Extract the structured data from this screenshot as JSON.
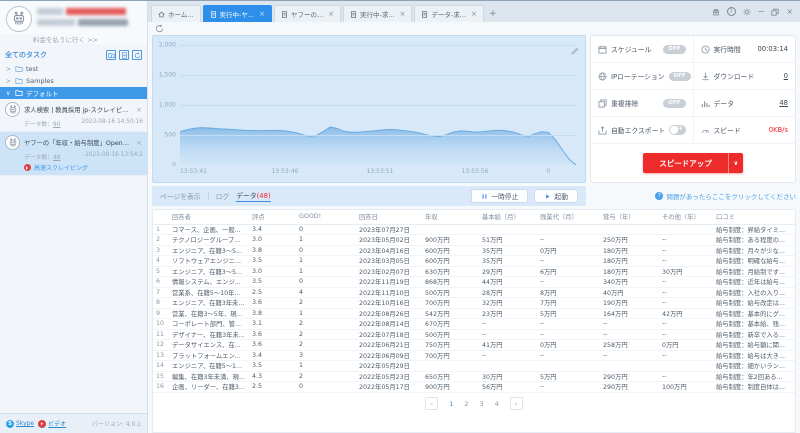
{
  "window_controls": [
    "gift",
    "help",
    "settings",
    "minimize",
    "restore",
    "close"
  ],
  "tabs": [
    {
      "label": "ホーム...",
      "icon": "home",
      "closable": false,
      "active": false
    },
    {
      "label": "実行中-ヤ...",
      "icon": "doc",
      "closable": true,
      "active": true
    },
    {
      "label": "ヤフーの...",
      "icon": "doc",
      "closable": true,
      "active": false
    },
    {
      "label": "実行中-求...",
      "icon": "doc",
      "closable": true,
      "active": false
    },
    {
      "label": "データ-求...",
      "icon": "doc",
      "closable": true,
      "active": false
    }
  ],
  "new_tab_label": "+",
  "sidebar": {
    "pay_link": "料金を払うに行く >>",
    "tasks_header": "全てのタスク",
    "folders": [
      {
        "name": "test",
        "expanded": false,
        "selected": false
      },
      {
        "name": "Samples",
        "expanded": false,
        "selected": false
      },
      {
        "name": "デフォルト",
        "expanded": true,
        "selected": true
      }
    ],
    "tasks": [
      {
        "title": "求人検索 | 教員採用 jp-スクレイピング中",
        "data_label": "データ数：",
        "count": "90",
        "time": "2023-08-16 14:50:16",
        "selected": false
      },
      {
        "title": "ヤフーの「年収・給与制度」OpenWork-ス...",
        "data_label": "データ数：",
        "count": "48",
        "time": "2023-08-16 13:54:2",
        "badge": "高速スクレイピング",
        "selected": true
      }
    ],
    "footer": {
      "skype": "Skype",
      "video": "ビデオ",
      "version": "バージョン: 4.0.1"
    }
  },
  "chart_data": {
    "type": "area",
    "title": "",
    "ylabel": "",
    "xlabel": "",
    "ylim": [
      0,
      2000
    ],
    "y_ticks": [
      "2,000",
      "1,500",
      "1,000",
      "500",
      "0"
    ],
    "x_labels": [
      "13:53:41",
      "13:53:46",
      "13:53:51",
      "13:53:56",
      "0"
    ],
    "grid": true,
    "line_color": "#69abe2",
    "values": [
      555,
      585,
      610,
      622,
      618,
      610,
      602,
      596,
      590,
      582,
      576,
      572,
      570,
      574,
      578,
      572,
      558,
      540,
      502,
      480,
      492,
      560,
      632,
      610,
      562,
      545,
      545,
      555,
      565,
      578,
      588,
      592,
      584,
      570,
      556,
      538,
      505,
      485,
      475,
      502,
      548,
      568,
      562,
      550,
      553,
      563,
      576,
      580,
      566,
      545,
      500,
      480,
      522,
      556,
      540,
      420,
      250,
      95,
      0
    ]
  },
  "panel": {
    "rows": [
      {
        "left_icon": "calendar",
        "left_label": "スケジュール",
        "badge": "OFF",
        "badge_type": "pill",
        "right_icon": "clock",
        "right_label": "実行時間",
        "right_value": "00:03:14",
        "value_style": "plain"
      },
      {
        "left_icon": "globe",
        "left_label": "IPローテーション",
        "badge": "OFF",
        "badge_type": "pill",
        "right_icon": "download",
        "right_label": "ダウンロード",
        "right_value": "0",
        "value_style": "link"
      },
      {
        "left_icon": "dedup",
        "left_label": "重複排除",
        "badge": "OFF",
        "badge_type": "pill",
        "right_icon": "data",
        "right_label": "データ",
        "right_value": "48",
        "value_style": "link"
      },
      {
        "left_icon": "export",
        "left_label": "自動エクスポート",
        "badge": "OFF",
        "badge_type": "switch",
        "right_icon": "gauge",
        "right_label": "スピード",
        "right_value": "0KB/s",
        "value_style": "red"
      }
    ],
    "speedup_label": "スピードアップ",
    "tip": "問題があったらここをクリックしてください"
  },
  "toolbar": {
    "page_view": "ページを表示",
    "log": "ログ",
    "data": "データ",
    "data_count": "(48)",
    "pause": "一時停止",
    "start": "起動"
  },
  "table": {
    "headers": [
      "",
      "回答者",
      "評点",
      "GOOD!",
      "回答日",
      "年収",
      "基本給（月）",
      "残業代（月）",
      "賞与（年）",
      "その他（年）",
      "口コミ"
    ],
    "rows": [
      [
        "1",
        "コマース、企画、一般...",
        "3.4",
        "0",
        "2023年07月27日",
        "",
        "",
        "",
        "",
        "",
        "給与制度：昇給タイミ..."
      ],
      [
        "2",
        "テクノロジーグループ...",
        "3.0",
        "1",
        "2023年05月02日",
        "900万円",
        "51万円",
        "--",
        "250万円",
        "--",
        "給与制度：ある程度の..."
      ],
      [
        "3",
        "エンジニア、在籍3～5...",
        "3.8",
        "0",
        "2023年04月16日",
        "600万円",
        "35万円",
        "0万円",
        "180万円",
        "--",
        "給与制度：月々が少な..."
      ],
      [
        "4",
        "ソフトウェアエンジニ...",
        "3.5",
        "1",
        "2023年03月05日",
        "600万円",
        "35万円",
        "--",
        "180万円",
        "--",
        "給与制度：明確な給与..."
      ],
      [
        "5",
        "エンジニア、在籍3～5...",
        "3.0",
        "1",
        "2023年02月07日",
        "630万円",
        "29万円",
        "6万円",
        "180万円",
        "30万円",
        "給与制度：月給制です..."
      ],
      [
        "6",
        "情報システム、エンジ...",
        "3.5",
        "0",
        "2022年11月19日",
        "868万円",
        "44万円",
        "--",
        "340万円",
        "--",
        "給与制度：近年は給与..."
      ],
      [
        "7",
        "営業系、在籍5～10年...",
        "2.5",
        "4",
        "2022年11月10日",
        "500万円",
        "28万円",
        "8万円",
        "40万円",
        "--",
        "給与制度：入社の入り..."
      ],
      [
        "8",
        "エンジニア、在籍3年未...",
        "3.6",
        "2",
        "2022年10月16日",
        "700万円",
        "32万円",
        "7万円",
        "190万円",
        "--",
        "給与制度：給与改定は..."
      ],
      [
        "9",
        "営業、在籍3～5年、現...",
        "3.8",
        "1",
        "2022年08月26日",
        "542万円",
        "23万円",
        "5万円",
        "164万円",
        "42万円",
        "給与制度：基本的にグ..."
      ],
      [
        "10",
        "コーポレート部門、管...",
        "3.1",
        "2",
        "2022年08月14日",
        "670万円",
        "--",
        "--",
        "--",
        "--",
        "給与制度：基本給、残..."
      ],
      [
        "11",
        "デザイナー、在籍3年未...",
        "3.6",
        "2",
        "2022年07月18日",
        "500万円",
        "--",
        "--",
        "--",
        "--",
        "給与制度：新卒で入る..."
      ],
      [
        "12",
        "データサイエンス、在...",
        "3.6",
        "2",
        "2022年06月21日",
        "750万円",
        "41万円",
        "0万円",
        "258万円",
        "0万円",
        "給与制度：給与額に関..."
      ],
      [
        "13",
        "プラットフォームエン...",
        "3.4",
        "3",
        "2022年06月09日",
        "700万円",
        "--",
        "--",
        "--",
        "--",
        "給与制度：給与は大き..."
      ],
      [
        "14",
        "エンジニア、在籍5～1...",
        "3.5",
        "1",
        "2022年05月29日",
        "",
        "",
        "",
        "",
        "",
        "給与制度：細かいラン..."
      ],
      [
        "15",
        "編集、在籍3年未満、現...",
        "4.3",
        "2",
        "2022年05月23日",
        "650万円",
        "30万円",
        "5万円",
        "290万円",
        "--",
        "給与制度：年2回ある..."
      ],
      [
        "16",
        "企画、リーダー、在籍3...",
        "2.5",
        "0",
        "2022年05月17日",
        "900万円",
        "56万円",
        "--",
        "290万円",
        "100万円",
        "給与制度：制度自体は..."
      ]
    ]
  },
  "pagination": {
    "prev": "‹",
    "pages": [
      "1",
      "2",
      "3",
      "4"
    ],
    "current": "1",
    "next": "›"
  }
}
